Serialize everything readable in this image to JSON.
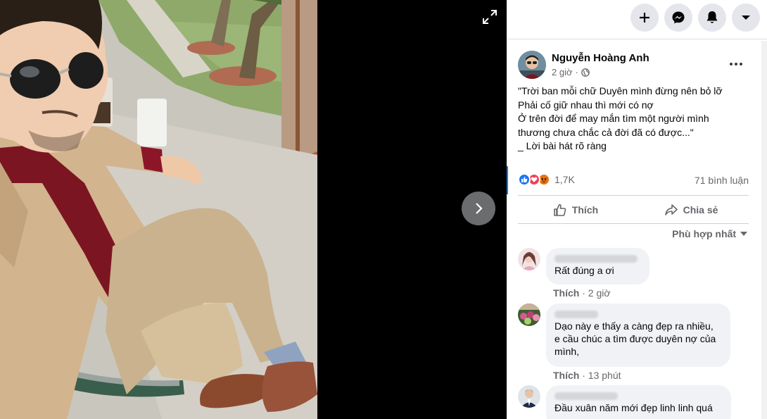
{
  "viewer": {
    "photo_desc": "selfie-photo",
    "controls": {
      "expand_icon": "expand-icon",
      "next_icon": "chevron-right-icon"
    }
  },
  "topnav": [
    {
      "name": "create-button",
      "icon": "plus-icon"
    },
    {
      "name": "messenger-button",
      "icon": "messenger-icon"
    },
    {
      "name": "notifications-button",
      "icon": "bell-icon"
    },
    {
      "name": "account-menu-button",
      "icon": "caret-down-icon"
    }
  ],
  "post": {
    "author": "Nguyễn Hoàng Anh",
    "time": "2 giờ",
    "privacy_icon": "globe-icon",
    "text_lines": [
      "\"Trời ban mỗi chữ Duyên mình đừng nên bỏ lỡ",
      "Phải cố giữ nhau thì mới có nợ",
      "Ở trên đời để may mắn tìm một người mình",
      "thương chưa chắc cả đời đã có được...\"",
      "_ Lời bài hát rõ ràng"
    ],
    "reaction_count": "1,7K",
    "comment_count": "71 bình luận",
    "actions": {
      "like": "Thích",
      "share": "Chia sẻ"
    },
    "sort_label": "Phù hợp nhất"
  },
  "comments": [
    {
      "text": "Rất đúng a ơi",
      "like": "Thích",
      "time": "2 giờ"
    },
    {
      "text_lines": [
        "Dạo này e thấy a càng đẹp ra nhiều,",
        "e cầu chúc a tìm được duyên nợ của",
        "mình,"
      ],
      "like": "Thích",
      "time": "13 phút"
    },
    {
      "text": "Đầu xuân năm mới đẹp linh linh quá"
    }
  ],
  "colors": {
    "accent": "#1877f2",
    "secondary_text": "#65676b",
    "bubble": "#f0f2f5"
  }
}
